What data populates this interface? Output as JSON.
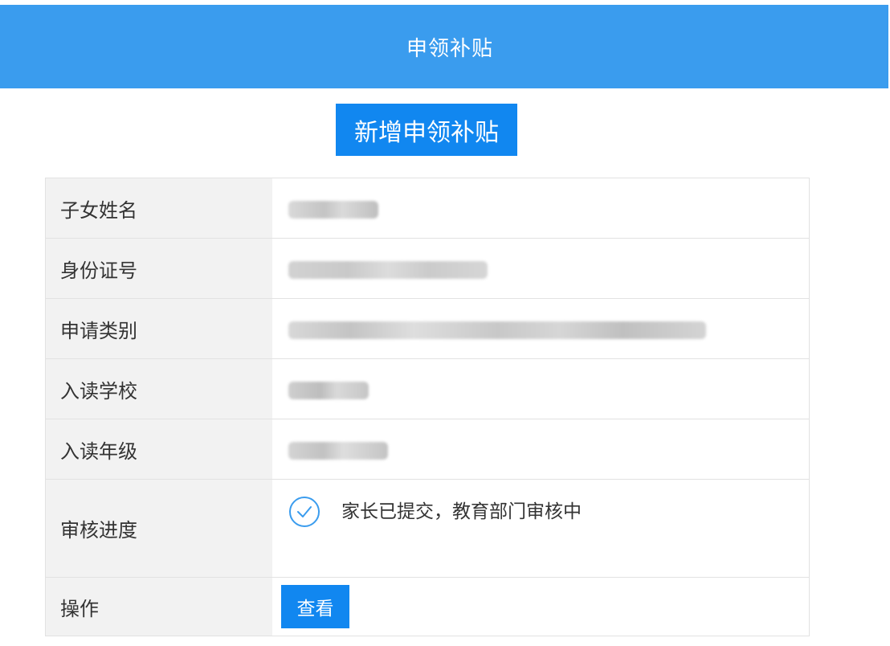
{
  "header": {
    "title": "申领补贴"
  },
  "actions": {
    "add_label": "新增申领补贴"
  },
  "record": {
    "rows": [
      {
        "label": "子女姓名",
        "value": ""
      },
      {
        "label": "身份证号",
        "value": ""
      },
      {
        "label": "申请类别",
        "value": ""
      },
      {
        "label": "入读学校",
        "value": ""
      },
      {
        "label": "入读年级",
        "value": ""
      },
      {
        "label": "审核进度",
        "status_text": "家长已提交，教育部门审核中",
        "status_icon": "check-circle-icon"
      },
      {
        "label": "操作",
        "view_label": "查看"
      }
    ]
  },
  "colors": {
    "header_bg": "#3a9cee",
    "button_bg": "#1187f0",
    "label_bg": "#f2f2f2",
    "border": "#e2e2e2",
    "check": "#3a9cee"
  }
}
